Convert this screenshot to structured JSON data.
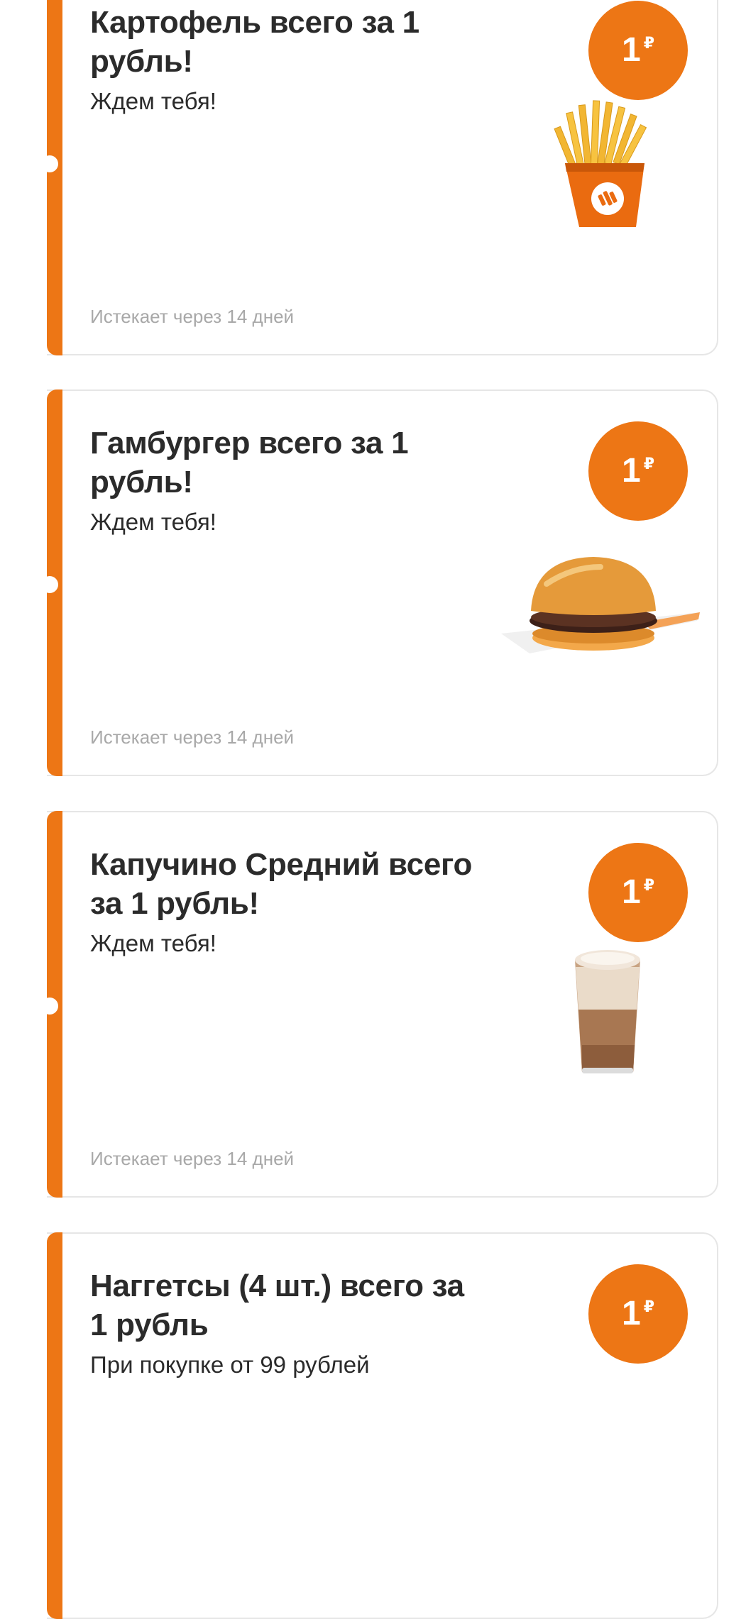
{
  "coupons": [
    {
      "title": "Картофель всего за 1 рубль!",
      "subtitle": "Ждем тебя!",
      "expiry": "Истекает через 14 дней",
      "price": "1",
      "currency": "₽",
      "product_icon": "fries-icon"
    },
    {
      "title": "Гамбургер всего за 1 рубль!",
      "subtitle": "Ждем тебя!",
      "expiry": "Истекает через 14 дней",
      "price": "1",
      "currency": "₽",
      "product_icon": "hamburger-icon"
    },
    {
      "title": "Капучино Средний всего за 1 рубль!",
      "subtitle": "Ждем тебя!",
      "expiry": "Истекает через 14 дней",
      "price": "1",
      "currency": "₽",
      "product_icon": "cappuccino-icon"
    },
    {
      "title": "Наггетсы (4 шт.) всего за 1 рубль",
      "subtitle": "При покупке от 99 рублей",
      "expiry": "",
      "price": "1",
      "currency": "₽",
      "product_icon": "nuggets-icon"
    }
  ],
  "colors": {
    "accent": "#ed7615",
    "card_border": "#e6e6e6",
    "text": "#2b2b2b",
    "muted": "#a8a8a8"
  }
}
